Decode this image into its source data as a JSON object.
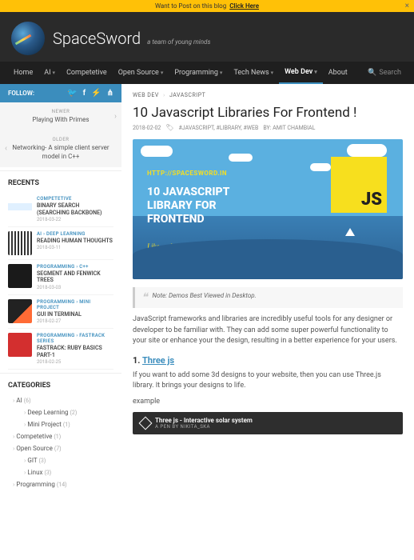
{
  "banner": {
    "text": "Want to Post on this blog",
    "link": "Click Here"
  },
  "brand": {
    "name": "SpaceSword",
    "tagline": "a team of young minds"
  },
  "nav": {
    "items": [
      {
        "label": "Home",
        "dropdown": false
      },
      {
        "label": "AI",
        "dropdown": true
      },
      {
        "label": "Competetive",
        "dropdown": false
      },
      {
        "label": "Open Source",
        "dropdown": true
      },
      {
        "label": "Programming",
        "dropdown": true
      },
      {
        "label": "Tech News",
        "dropdown": true
      },
      {
        "label": "Web Dev",
        "dropdown": true,
        "active": true
      },
      {
        "label": "About",
        "dropdown": false
      }
    ],
    "search_placeholder": "Search"
  },
  "follow": {
    "label": "FOLLOW:"
  },
  "postnav": {
    "newer": {
      "label": "NEWER",
      "title": "Playing With Primes"
    },
    "older": {
      "label": "OLDER",
      "title": "Networking- A simple client server model in C++"
    }
  },
  "recents": {
    "heading": "RECENTS",
    "items": [
      {
        "cat": "COMPETETIVE",
        "title": "BINARY SEARCH (SEARCHING BACKBONE)",
        "date": "2018-03-22"
      },
      {
        "cat": "AI › DEEP LEARNING",
        "title": "READING HUMAN THOUGHTS",
        "date": "2018-03-11"
      },
      {
        "cat": "PROGRAMMING › C++",
        "title": "SEGMENT AND FENWICK TREES",
        "date": "2018-03-03"
      },
      {
        "cat": "PROGRAMMING › MINI PROJECT",
        "title": "GUI IN TERMINAL",
        "date": "2018-02-27"
      },
      {
        "cat": "PROGRAMMING › FASTRACK SERIES",
        "title": "FASTRACK: RUBY BASICS PART-1",
        "date": "2018-02-25"
      }
    ]
  },
  "categories": {
    "heading": "CATEGORIES",
    "items": [
      {
        "label": "AI",
        "count": "(6)",
        "subs": [
          {
            "label": "Deep Learning",
            "count": "(2)"
          },
          {
            "label": "Mini Project",
            "count": "(1)"
          }
        ]
      },
      {
        "label": "Competetive",
        "count": "(1)"
      },
      {
        "label": "Open Source",
        "count": "(7)",
        "subs": [
          {
            "label": "GIT",
            "count": "(3)"
          },
          {
            "label": "Linux",
            "count": "(3)"
          }
        ]
      },
      {
        "label": "Programming",
        "count": "(14)"
      }
    ]
  },
  "breadcrumb": {
    "a": "WEB DEV",
    "b": "JAVASCRIPT"
  },
  "article": {
    "title": "10 Javascript Libraries For Frontend !",
    "date": "2018-02-02",
    "tags": "#JAVASCRIPT, #LIBRARY, #WEB",
    "author": "BY: AMIT CHAMBIAL",
    "hero": {
      "url": "HTTP://SPACESWORD.IN",
      "headline": "10 JAVASCRIPT LIBRARY FOR FRONTEND",
      "sub": "Like and Share!",
      "badge": "JS"
    },
    "note": "Note: Demos Best Viewed in Desktop.",
    "intro": "JavaScript frameworks and libraries are incredibly useful tools for any designer or developer to be familiar with. They can add some super powerful functionality to your site or enhance your the design, resulting in a better experience for your users.",
    "section1": {
      "num": "1.",
      "name": "Three js",
      "desc": "If you want to add some 3d designs to your website, then you can use Three.js library. It brings your designs to life.",
      "example_label": "example"
    },
    "embed": {
      "title": "Three js - Interactive solar system",
      "author": "A PEN BY nikita_ska"
    }
  }
}
